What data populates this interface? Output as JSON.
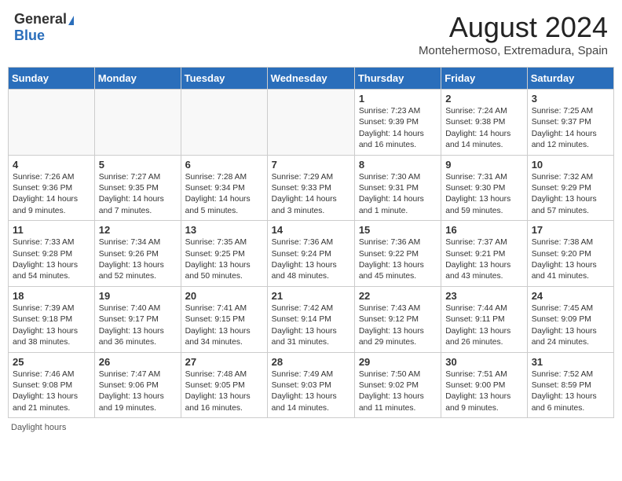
{
  "header": {
    "logo_general": "General",
    "logo_blue": "Blue",
    "month_year": "August 2024",
    "location": "Montehermoso, Extremadura, Spain"
  },
  "weekdays": [
    "Sunday",
    "Monday",
    "Tuesday",
    "Wednesday",
    "Thursday",
    "Friday",
    "Saturday"
  ],
  "weeks": [
    [
      {
        "day": "",
        "info": ""
      },
      {
        "day": "",
        "info": ""
      },
      {
        "day": "",
        "info": ""
      },
      {
        "day": "",
        "info": ""
      },
      {
        "day": "1",
        "info": "Sunrise: 7:23 AM\nSunset: 9:39 PM\nDaylight: 14 hours and 16 minutes."
      },
      {
        "day": "2",
        "info": "Sunrise: 7:24 AM\nSunset: 9:38 PM\nDaylight: 14 hours and 14 minutes."
      },
      {
        "day": "3",
        "info": "Sunrise: 7:25 AM\nSunset: 9:37 PM\nDaylight: 14 hours and 12 minutes."
      }
    ],
    [
      {
        "day": "4",
        "info": "Sunrise: 7:26 AM\nSunset: 9:36 PM\nDaylight: 14 hours and 9 minutes."
      },
      {
        "day": "5",
        "info": "Sunrise: 7:27 AM\nSunset: 9:35 PM\nDaylight: 14 hours and 7 minutes."
      },
      {
        "day": "6",
        "info": "Sunrise: 7:28 AM\nSunset: 9:34 PM\nDaylight: 14 hours and 5 minutes."
      },
      {
        "day": "7",
        "info": "Sunrise: 7:29 AM\nSunset: 9:33 PM\nDaylight: 14 hours and 3 minutes."
      },
      {
        "day": "8",
        "info": "Sunrise: 7:30 AM\nSunset: 9:31 PM\nDaylight: 14 hours and 1 minute."
      },
      {
        "day": "9",
        "info": "Sunrise: 7:31 AM\nSunset: 9:30 PM\nDaylight: 13 hours and 59 minutes."
      },
      {
        "day": "10",
        "info": "Sunrise: 7:32 AM\nSunset: 9:29 PM\nDaylight: 13 hours and 57 minutes."
      }
    ],
    [
      {
        "day": "11",
        "info": "Sunrise: 7:33 AM\nSunset: 9:28 PM\nDaylight: 13 hours and 54 minutes."
      },
      {
        "day": "12",
        "info": "Sunrise: 7:34 AM\nSunset: 9:26 PM\nDaylight: 13 hours and 52 minutes."
      },
      {
        "day": "13",
        "info": "Sunrise: 7:35 AM\nSunset: 9:25 PM\nDaylight: 13 hours and 50 minutes."
      },
      {
        "day": "14",
        "info": "Sunrise: 7:36 AM\nSunset: 9:24 PM\nDaylight: 13 hours and 48 minutes."
      },
      {
        "day": "15",
        "info": "Sunrise: 7:36 AM\nSunset: 9:22 PM\nDaylight: 13 hours and 45 minutes."
      },
      {
        "day": "16",
        "info": "Sunrise: 7:37 AM\nSunset: 9:21 PM\nDaylight: 13 hours and 43 minutes."
      },
      {
        "day": "17",
        "info": "Sunrise: 7:38 AM\nSunset: 9:20 PM\nDaylight: 13 hours and 41 minutes."
      }
    ],
    [
      {
        "day": "18",
        "info": "Sunrise: 7:39 AM\nSunset: 9:18 PM\nDaylight: 13 hours and 38 minutes."
      },
      {
        "day": "19",
        "info": "Sunrise: 7:40 AM\nSunset: 9:17 PM\nDaylight: 13 hours and 36 minutes."
      },
      {
        "day": "20",
        "info": "Sunrise: 7:41 AM\nSunset: 9:15 PM\nDaylight: 13 hours and 34 minutes."
      },
      {
        "day": "21",
        "info": "Sunrise: 7:42 AM\nSunset: 9:14 PM\nDaylight: 13 hours and 31 minutes."
      },
      {
        "day": "22",
        "info": "Sunrise: 7:43 AM\nSunset: 9:12 PM\nDaylight: 13 hours and 29 minutes."
      },
      {
        "day": "23",
        "info": "Sunrise: 7:44 AM\nSunset: 9:11 PM\nDaylight: 13 hours and 26 minutes."
      },
      {
        "day": "24",
        "info": "Sunrise: 7:45 AM\nSunset: 9:09 PM\nDaylight: 13 hours and 24 minutes."
      }
    ],
    [
      {
        "day": "25",
        "info": "Sunrise: 7:46 AM\nSunset: 9:08 PM\nDaylight: 13 hours and 21 minutes."
      },
      {
        "day": "26",
        "info": "Sunrise: 7:47 AM\nSunset: 9:06 PM\nDaylight: 13 hours and 19 minutes."
      },
      {
        "day": "27",
        "info": "Sunrise: 7:48 AM\nSunset: 9:05 PM\nDaylight: 13 hours and 16 minutes."
      },
      {
        "day": "28",
        "info": "Sunrise: 7:49 AM\nSunset: 9:03 PM\nDaylight: 13 hours and 14 minutes."
      },
      {
        "day": "29",
        "info": "Sunrise: 7:50 AM\nSunset: 9:02 PM\nDaylight: 13 hours and 11 minutes."
      },
      {
        "day": "30",
        "info": "Sunrise: 7:51 AM\nSunset: 9:00 PM\nDaylight: 13 hours and 9 minutes."
      },
      {
        "day": "31",
        "info": "Sunrise: 7:52 AM\nSunset: 8:59 PM\nDaylight: 13 hours and 6 minutes."
      }
    ]
  ],
  "footer": "Daylight hours"
}
